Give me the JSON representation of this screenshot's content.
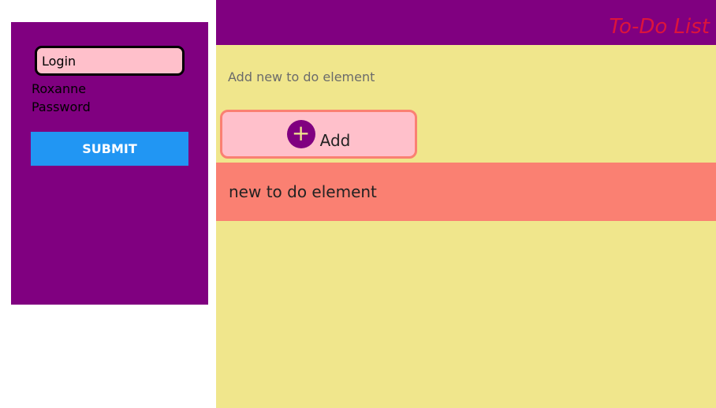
{
  "login": {
    "input_value": "Login",
    "username": "Roxanne",
    "password_label": "Password",
    "submit_label": "SUBMIT"
  },
  "todo": {
    "title": "To-Do List",
    "input_placeholder": "Add new to do element",
    "add_label": "Add",
    "add_icon": "plus-circle-icon",
    "items": [
      {
        "text": "new to do element"
      }
    ]
  },
  "colors": {
    "panel": "#800080",
    "input_bg": "#ffc0cb",
    "submit": "#2196f3",
    "list_bg": "#f0e68c",
    "title": "#dc143c",
    "item_bg": "#fa8072"
  }
}
